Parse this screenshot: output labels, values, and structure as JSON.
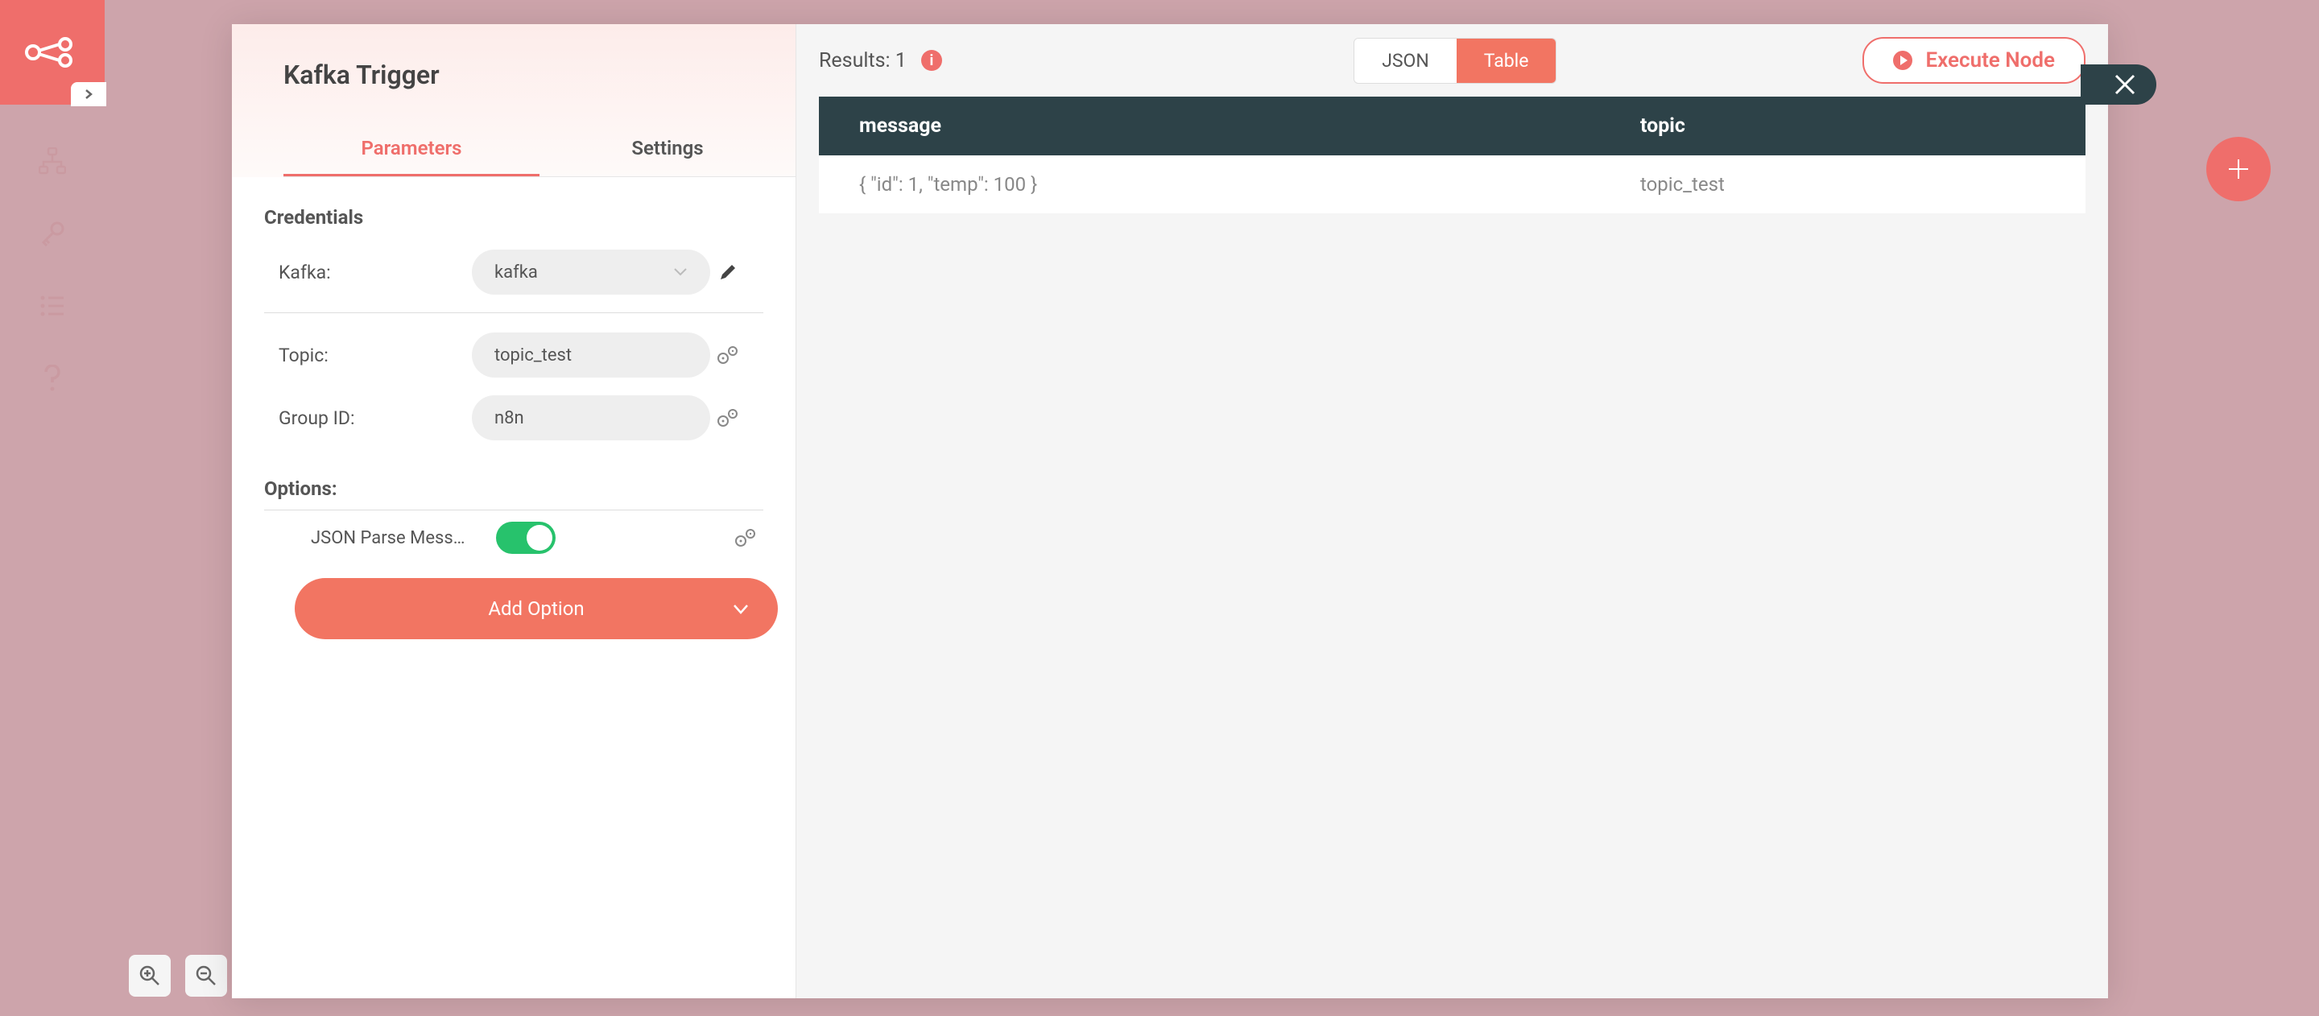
{
  "sidebar": {
    "icons": [
      "workflow-icon",
      "key-icon",
      "list-icon",
      "help-icon"
    ]
  },
  "node": {
    "title": "Kafka Trigger",
    "tabs": {
      "parameters": "Parameters",
      "settings": "Settings"
    },
    "credentials": {
      "heading": "Credentials",
      "kafka_label": "Kafka:",
      "kafka_value": "kafka"
    },
    "fields": {
      "topic_label": "Topic:",
      "topic_value": "topic_test",
      "group_label": "Group ID:",
      "group_value": "n8n"
    },
    "options": {
      "heading": "Options:",
      "json_parse_label": "JSON Parse Mess…",
      "json_parse_on": true,
      "add_option": "Add Option"
    }
  },
  "results": {
    "label": "Results: 1",
    "view": {
      "json": "JSON",
      "table": "Table"
    },
    "execute": "Execute Node",
    "columns": {
      "message": "message",
      "topic": "topic"
    },
    "rows": [
      {
        "message": "{ \"id\": 1, \"temp\": 100 }",
        "topic": "topic_test"
      }
    ]
  }
}
